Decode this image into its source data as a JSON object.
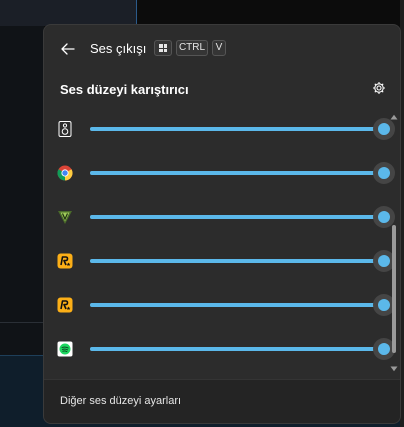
{
  "header": {
    "title": "Ses çıkışı",
    "shortcut_keys": [
      "CTRL",
      "V"
    ],
    "back_icon": "arrow-left-icon",
    "windows_key_icon": "windows-logo-icon"
  },
  "mixer": {
    "title": "Ses düzeyi karıştırıcı",
    "settings_icon": "gear-icon",
    "accent_color": "#5bb8ea",
    "items": [
      {
        "icon": "speaker-icon",
        "volume": 100
      },
      {
        "icon": "chrome-icon",
        "volume": 100
      },
      {
        "icon": "gta-v-icon",
        "volume": 100
      },
      {
        "icon": "rockstar-icon",
        "volume": 100
      },
      {
        "icon": "rockstar-icon",
        "volume": 100
      },
      {
        "icon": "spotify-icon",
        "volume": 100
      }
    ]
  },
  "footer": {
    "link_label": "Diğer ses düzeyi ayarları"
  }
}
